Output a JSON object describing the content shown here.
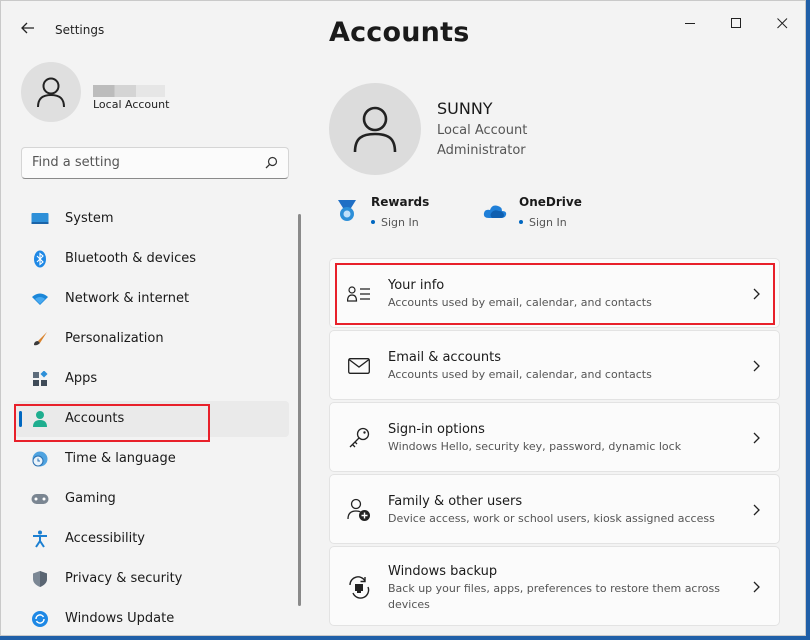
{
  "window": {
    "app_title": "Settings",
    "back_glyph": "←",
    "minimize_glyph": "—",
    "close_glyph": "✕"
  },
  "profile": {
    "sub_label": "Local Account"
  },
  "search": {
    "placeholder": "Find a setting"
  },
  "nav": {
    "items": [
      {
        "label": "System",
        "icon": "monitor-icon"
      },
      {
        "label": "Bluetooth & devices",
        "icon": "bluetooth-icon"
      },
      {
        "label": "Network & internet",
        "icon": "wifi-icon"
      },
      {
        "label": "Personalization",
        "icon": "brush-icon"
      },
      {
        "label": "Apps",
        "icon": "apps-icon"
      },
      {
        "label": "Accounts",
        "icon": "person-icon"
      },
      {
        "label": "Time & language",
        "icon": "globe-clock-icon"
      },
      {
        "label": "Gaming",
        "icon": "gamepad-icon"
      },
      {
        "label": "Accessibility",
        "icon": "accessibility-icon"
      },
      {
        "label": "Privacy & security",
        "icon": "shield-icon"
      },
      {
        "label": "Windows Update",
        "icon": "update-icon"
      }
    ],
    "active_label": "Accounts"
  },
  "main": {
    "title": "Accounts",
    "user": {
      "name": "SUNNY",
      "type": "Local Account",
      "role": "Administrator"
    },
    "services": [
      {
        "name": "Rewards",
        "link": "Sign In",
        "icon": "rewards-medal-icon"
      },
      {
        "name": "OneDrive",
        "link": "Sign In",
        "icon": "onedrive-cloud-icon"
      }
    ],
    "cards": [
      {
        "title": "Your info",
        "subtitle": "Accounts used by email, calendar, and contacts",
        "icon": "user-info-icon"
      },
      {
        "title": "Email & accounts",
        "subtitle": "Accounts used by email, calendar, and contacts",
        "icon": "mail-icon"
      },
      {
        "title": "Sign-in options",
        "subtitle": "Windows Hello, security key, password, dynamic lock",
        "icon": "key-icon"
      },
      {
        "title": "Family & other users",
        "subtitle": "Device access, work or school users, kiosk assigned access",
        "icon": "add-user-icon"
      },
      {
        "title": "Windows backup",
        "subtitle": "Back up your files, apps, preferences to restore them across devices",
        "icon": "backup-icon"
      }
    ]
  },
  "colors": {
    "accent": "#0067c0",
    "highlight": "#e8202a",
    "window_bg": "#f3f3f3",
    "card_bg": "#fbfbfb"
  }
}
